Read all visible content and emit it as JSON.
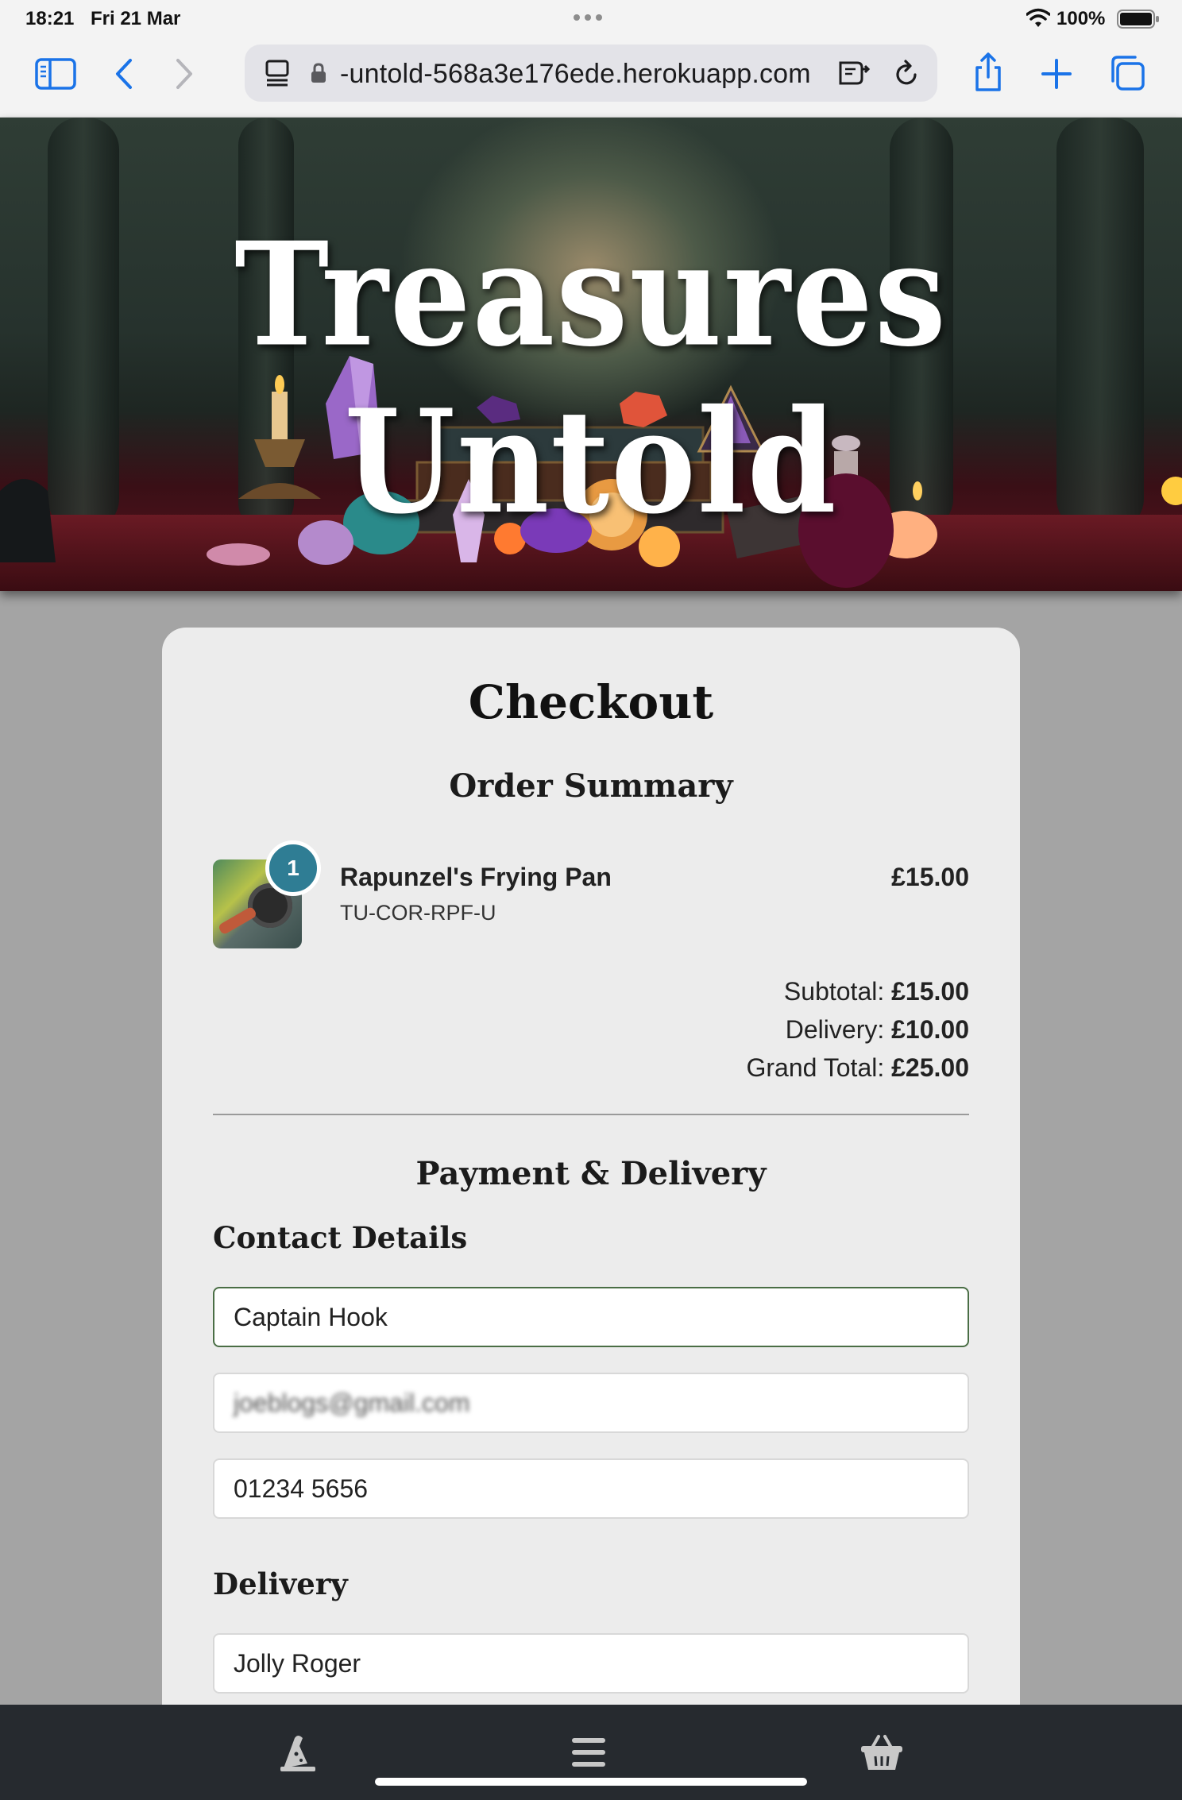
{
  "status_bar": {
    "time": "18:21",
    "date": "Fri 21 Mar",
    "battery_percent": "100%"
  },
  "browser": {
    "url": "-untold-568a3e176ede.herokuapp.com",
    "icons": [
      "sidebar-icon",
      "back-icon",
      "forward-icon",
      "page-menu-icon",
      "lock-icon",
      "reader-icon",
      "reload-icon",
      "share-icon",
      "new-tab-icon",
      "tabs-icon"
    ]
  },
  "site": {
    "title": "Treasures Untold"
  },
  "checkout": {
    "title": "Checkout",
    "order_summary_title": "Order Summary",
    "item": {
      "quantity": "1",
      "name": "Rapunzel's Frying Pan",
      "sku": "TU-COR-RPF-U",
      "price": "£15.00"
    },
    "subtotal_label": "Subtotal:",
    "subtotal_value": "£15.00",
    "delivery_label": "Delivery:",
    "delivery_value": "£10.00",
    "grand_total_label": "Grand Total:",
    "grand_total_value": "£25.00",
    "payment_title": "Payment & Delivery",
    "contact_title": "Contact Details",
    "contact_fields": {
      "full_name": "Captain Hook",
      "email": "joeblogs@gmail.com",
      "phone": "01234 5656"
    },
    "delivery_title": "Delivery",
    "delivery_fields": {
      "address_line": "Jolly Roger"
    }
  },
  "bottom_nav": {
    "icons": [
      "wizard-hat-icon",
      "menu-icon",
      "basket-icon"
    ]
  },
  "colors": {
    "badge": "#2f7d94",
    "card_bg": "#ececec",
    "page_bg": "#a4a4a4",
    "nav_bg": "#262a2f",
    "focused_border": "#4a6e45",
    "safari_blue": "#1a73e8"
  }
}
